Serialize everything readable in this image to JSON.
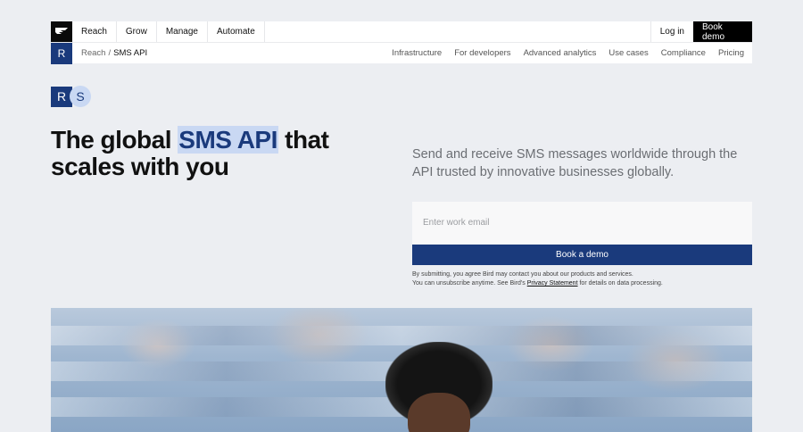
{
  "nav": {
    "items": [
      "Reach",
      "Grow",
      "Manage",
      "Automate"
    ],
    "login_label": "Log in",
    "book_demo_label": "Book demo"
  },
  "subnav": {
    "badge": "R",
    "breadcrumb_parent": "Reach",
    "breadcrumb_sep": "/",
    "breadcrumb_current": "SMS API",
    "links": [
      "Infrastructure",
      "For developers",
      "Advanced analytics",
      "Use cases",
      "Compliance",
      "Pricing"
    ]
  },
  "product_icons": {
    "r": "R",
    "s": "S"
  },
  "hero": {
    "title_before": "The global ",
    "title_highlight": "SMS API",
    "title_after": " that scales with you",
    "description": "Send and receive SMS messages worldwide through the API trusted by innovative businesses globally.",
    "email_placeholder": "Enter work email",
    "cta_label": "Book a demo",
    "disclaimer_line1": "By submitting, you agree Bird may contact you about our products and services.",
    "disclaimer_line2_pre": "You can unsubscribe anytime. See Bird's ",
    "disclaimer_link": "Privacy Statement",
    "disclaimer_line2_post": " for details on data processing."
  },
  "colors": {
    "accent": "#1a3a7c",
    "highlight": "#c9d8f3",
    "background": "#eceef2"
  }
}
